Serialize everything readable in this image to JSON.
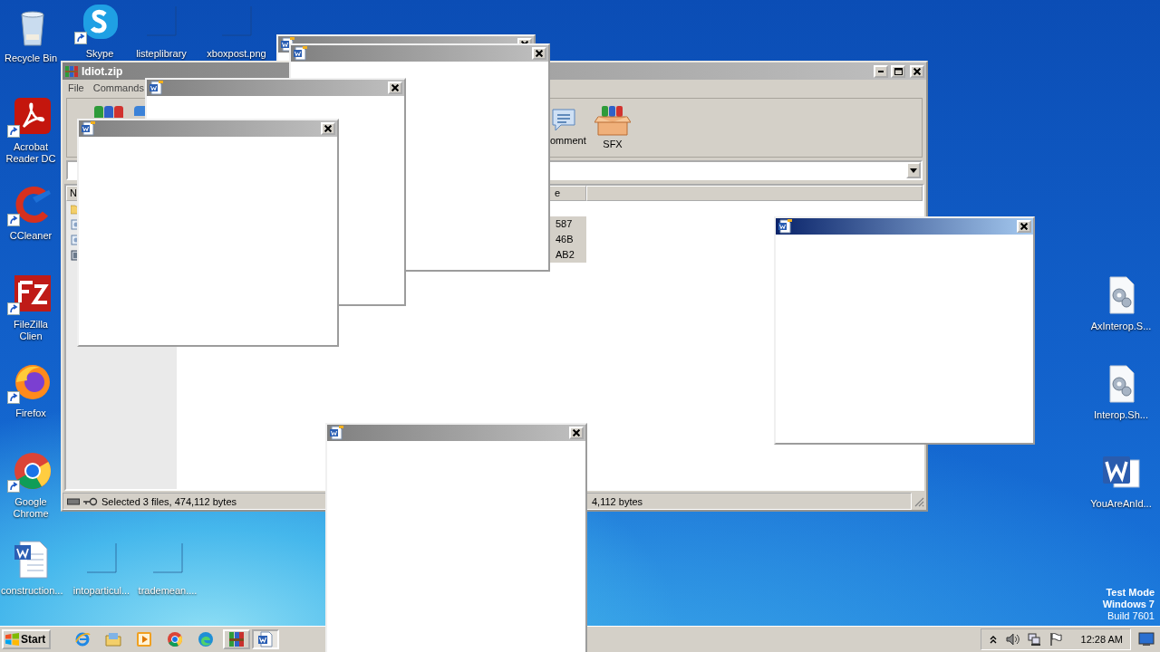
{
  "desktop": {
    "left_icons": [
      {
        "label": "Recycle Bin",
        "kind": "recycle-bin",
        "shortcut": false
      },
      {
        "label": "Acrobat Reader DC",
        "kind": "acrobat",
        "shortcut": true
      },
      {
        "label": "CCleaner",
        "kind": "ccleaner",
        "shortcut": true
      },
      {
        "label": "FileZilla Clien",
        "kind": "filezilla",
        "shortcut": true
      },
      {
        "label": "Firefox",
        "kind": "firefox",
        "shortcut": true
      },
      {
        "label": "Google Chrome",
        "kind": "chrome",
        "shortcut": true
      },
      {
        "label": "construction...",
        "kind": "word-doc",
        "shortcut": false
      }
    ],
    "top_icons": [
      {
        "label": "Skype",
        "kind": "skype",
        "shortcut": true
      },
      {
        "label": "listeplibrary",
        "kind": "blank",
        "shortcut": false
      },
      {
        "label": "xboxpost.png",
        "kind": "blank",
        "shortcut": false
      }
    ],
    "bottom_icons": [
      {
        "label": "intoparticul...",
        "kind": "blank",
        "shortcut": false
      },
      {
        "label": "trademean....",
        "kind": "blank",
        "shortcut": false
      }
    ],
    "right_icons": [
      {
        "label": "AxInterop.S...",
        "kind": "config",
        "shortcut": false
      },
      {
        "label": "Interop.Sh...",
        "kind": "config",
        "shortcut": false
      },
      {
        "label": "YouAreAnId...",
        "kind": "word",
        "shortcut": false
      }
    ],
    "system_notice": [
      "Test Mode",
      "Windows 7",
      "Build 7601"
    ]
  },
  "archiver_window": {
    "title": "Idiot.zip",
    "active": false,
    "menu": [
      "File",
      "Commands"
    ],
    "toolbar": [
      {
        "kind": "add"
      },
      {
        "kind": "extract"
      },
      {
        "kind": "comment",
        "label": "omment"
      },
      {
        "kind": "sfx",
        "label": "SFX"
      }
    ],
    "list": {
      "columns": [
        "N",
        "e"
      ],
      "rows": [
        {
          "kind": "folder",
          "selected": false
        },
        {
          "kind": "file",
          "selected": true,
          "column_2": "587"
        },
        {
          "kind": "file",
          "selected": true,
          "column_2": "46B"
        },
        {
          "kind": "text",
          "selected": true,
          "column_2": "AB2"
        }
      ]
    },
    "status": [
      "Selected 3 files, 474,112 bytes",
      "4,112 bytes"
    ]
  },
  "popups": [
    {
      "active": false
    },
    {
      "active": false
    },
    {
      "active": false
    },
    {
      "active": false
    },
    {
      "active": true
    },
    {
      "active": false
    }
  ],
  "taskbar": {
    "start": "Start",
    "items": [
      {
        "kind": "ie",
        "active": false
      },
      {
        "kind": "explorer",
        "active": false
      },
      {
        "kind": "media",
        "active": false
      },
      {
        "kind": "chrome",
        "active": false
      },
      {
        "kind": "edge",
        "active": false
      },
      {
        "kind": "winrar",
        "active": false
      },
      {
        "kind": "word",
        "active": true
      }
    ],
    "clock": "12:28 AM"
  }
}
